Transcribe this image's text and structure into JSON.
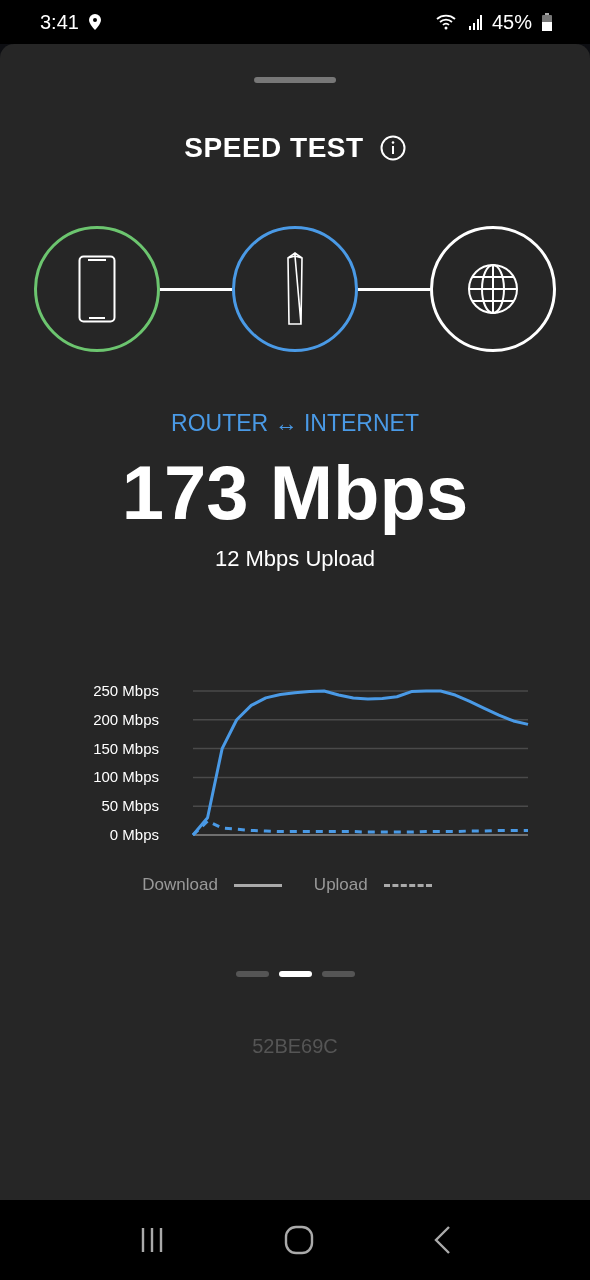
{
  "status_bar": {
    "time": "3:41",
    "battery": "45%"
  },
  "title": "SPEED TEST",
  "nodes": [
    {
      "kind": "phone",
      "color": "#6cc56f"
    },
    {
      "kind": "router",
      "color": "#4a9ae6"
    },
    {
      "kind": "globe",
      "color": "#ffffff"
    }
  ],
  "route_label": "ROUTER ↔ INTERNET",
  "download_speed": "173 Mbps",
  "upload_speed": "12 Mbps Upload",
  "chart_data": {
    "type": "line",
    "yticks": [
      {
        "value": 0,
        "label": "0 Mbps"
      },
      {
        "value": 50,
        "label": "50 Mbps"
      },
      {
        "value": 100,
        "label": "100 Mbps"
      },
      {
        "value": 150,
        "label": "150 Mbps"
      },
      {
        "value": 200,
        "label": "200 Mbps"
      },
      {
        "value": 250,
        "label": "250 Mbps"
      }
    ],
    "ylim": [
      0,
      250
    ],
    "grid": true,
    "series": [
      {
        "name": "Download",
        "color": "#4a9ae6",
        "line_style": "solid",
        "values": [
          0,
          30,
          150,
          200,
          225,
          238,
          244,
          247,
          249,
          250,
          243,
          238,
          236,
          237,
          240,
          249,
          250,
          250,
          243,
          232,
          220,
          208,
          198,
          192
        ]
      },
      {
        "name": "Upload",
        "color": "#4a9ae6",
        "line_style": "dashed",
        "values": [
          0,
          24,
          12,
          10,
          8,
          7,
          6,
          6,
          6,
          6,
          6,
          6,
          5,
          5,
          5,
          5,
          6,
          6,
          6,
          7,
          7,
          8,
          8,
          8
        ]
      }
    ]
  },
  "pages": [
    {
      "selected": false
    },
    {
      "selected": true
    },
    {
      "selected": false
    }
  ],
  "device_id": "52BE69C"
}
